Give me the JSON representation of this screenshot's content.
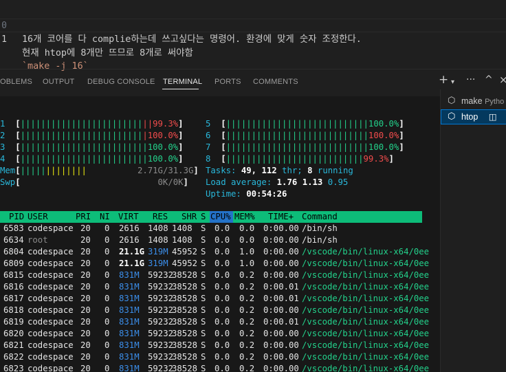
{
  "editor": {
    "lines": [
      {
        "num": "0",
        "text": "16개 코어를 다 complie하는데 쓰고싶다는 명령어. 환경에 맞게 숫자 조정한다."
      },
      {
        "num": "1",
        "text": "현재 htop에 8개만 뜨므로 8개로 써야함"
      },
      {
        "num": "",
        "text": "`make -j 16`"
      }
    ]
  },
  "panel": {
    "tabs": [
      "OBLEMS",
      "OUTPUT",
      "DEBUG CONSOLE",
      "TERMINAL",
      "PORTS",
      "COMMENTS"
    ],
    "active_tab": "TERMINAL",
    "icons": [
      "plus-icon",
      "chevron-down-icon",
      "ellipsis-icon",
      "chevron-up-icon",
      "close-icon"
    ]
  },
  "terminals": [
    {
      "name": "make",
      "sub": "Pytho",
      "icon": "terminal-icon"
    },
    {
      "name": "htop",
      "sub": "",
      "icon": "terminal-icon",
      "selected": true
    }
  ],
  "htop": {
    "cpus_left": [
      {
        "id": "1",
        "pct": "99.3%"
      },
      {
        "id": "2",
        "pct": "100.0%"
      },
      {
        "id": "3",
        "pct": "100.0%"
      },
      {
        "id": "4",
        "pct": "100.0%"
      }
    ],
    "cpus_right": [
      {
        "id": "5",
        "pct": "100.0%"
      },
      {
        "id": "6",
        "pct": "100.0%"
      },
      {
        "id": "7",
        "pct": "100.0%"
      },
      {
        "id": "8",
        "pct": "99.3%"
      }
    ],
    "mem_label": "Mem",
    "mem_value": "2.71G/31.3G",
    "swp_label": "Swp",
    "swp_value": "0K/0K",
    "tasks_label": "Tasks:",
    "tasks_total": "49,",
    "threads": "112",
    "thr_label": "thr;",
    "running": "8",
    "running_label": "running",
    "load_label": "Load average:",
    "load1": "1.76",
    "load5": "1.13",
    "load15": "0.95",
    "uptime_label": "Uptime:",
    "uptime": "00:54:26",
    "columns": [
      "PID",
      "USER",
      "PRI",
      "NI",
      "VIRT",
      "RES",
      "SHR",
      "S",
      "CPU%",
      "MEM%",
      "TIME+",
      "Command"
    ],
    "processes": [
      {
        "pid": "6583",
        "user": "codespace",
        "pri": "20",
        "ni": "0",
        "virt": "2616",
        "res": "1408",
        "shr": "1408",
        "s": "S",
        "cpu": "0.0",
        "mem": "0.0",
        "time": "0:00.00",
        "cmd": "/bin/sh"
      },
      {
        "pid": "6634",
        "user": "root",
        "pri": "20",
        "ni": "0",
        "virt": "2616",
        "res": "1408",
        "shr": "1408",
        "s": "S",
        "cpu": "0.0",
        "mem": "0.0",
        "time": "0:00.00",
        "cmd": "/bin/sh"
      },
      {
        "pid": "6804",
        "user": "codespace",
        "pri": "20",
        "ni": "0",
        "virt": "21.1G",
        "res": "319M",
        "shr": "45952",
        "s": "S",
        "cpu": "0.0",
        "mem": "1.0",
        "time": "0:00.00",
        "cmd": "/vscode/bin/linux-x64/0ee"
      },
      {
        "pid": "6809",
        "user": "codespace",
        "pri": "20",
        "ni": "0",
        "virt": "21.1G",
        "res": "319M",
        "shr": "45952",
        "s": "S",
        "cpu": "0.0",
        "mem": "1.0",
        "time": "0:00.00",
        "cmd": "/vscode/bin/linux-x64/0ee"
      },
      {
        "pid": "6815",
        "user": "codespace",
        "pri": "20",
        "ni": "0",
        "virt": "831M",
        "res": "59232",
        "shr": "38528",
        "s": "S",
        "cpu": "0.0",
        "mem": "0.2",
        "time": "0:00.00",
        "cmd": "/vscode/bin/linux-x64/0ee"
      },
      {
        "pid": "6816",
        "user": "codespace",
        "pri": "20",
        "ni": "0",
        "virt": "831M",
        "res": "59232",
        "shr": "38528",
        "s": "S",
        "cpu": "0.0",
        "mem": "0.2",
        "time": "0:00.01",
        "cmd": "/vscode/bin/linux-x64/0ee"
      },
      {
        "pid": "6817",
        "user": "codespace",
        "pri": "20",
        "ni": "0",
        "virt": "831M",
        "res": "59232",
        "shr": "38528",
        "s": "S",
        "cpu": "0.0",
        "mem": "0.2",
        "time": "0:00.01",
        "cmd": "/vscode/bin/linux-x64/0ee"
      },
      {
        "pid": "6818",
        "user": "codespace",
        "pri": "20",
        "ni": "0",
        "virt": "831M",
        "res": "59232",
        "shr": "38528",
        "s": "S",
        "cpu": "0.0",
        "mem": "0.2",
        "time": "0:00.00",
        "cmd": "/vscode/bin/linux-x64/0ee"
      },
      {
        "pid": "6819",
        "user": "codespace",
        "pri": "20",
        "ni": "0",
        "virt": "831M",
        "res": "59232",
        "shr": "38528",
        "s": "S",
        "cpu": "0.0",
        "mem": "0.2",
        "time": "0:00.01",
        "cmd": "/vscode/bin/linux-x64/0ee"
      },
      {
        "pid": "6820",
        "user": "codespace",
        "pri": "20",
        "ni": "0",
        "virt": "831M",
        "res": "59232",
        "shr": "38528",
        "s": "S",
        "cpu": "0.0",
        "mem": "0.2",
        "time": "0:00.00",
        "cmd": "/vscode/bin/linux-x64/0ee"
      },
      {
        "pid": "6821",
        "user": "codespace",
        "pri": "20",
        "ni": "0",
        "virt": "831M",
        "res": "59232",
        "shr": "38528",
        "s": "S",
        "cpu": "0.0",
        "mem": "0.2",
        "time": "0:00.00",
        "cmd": "/vscode/bin/linux-x64/0ee"
      },
      {
        "pid": "6822",
        "user": "codespace",
        "pri": "20",
        "ni": "0",
        "virt": "831M",
        "res": "59232",
        "shr": "38528",
        "s": "S",
        "cpu": "0.0",
        "mem": "0.2",
        "time": "0:00.00",
        "cmd": "/vscode/bin/linux-x64/0ee"
      },
      {
        "pid": "6823",
        "user": "codespace",
        "pri": "20",
        "ni": "0",
        "virt": "831M",
        "res": "59232",
        "shr": "38528",
        "s": "S",
        "cpu": "0.0",
        "mem": "0.2",
        "time": "0:00.00",
        "cmd": "/vscode/bin/linux-x64/0ee"
      }
    ]
  }
}
